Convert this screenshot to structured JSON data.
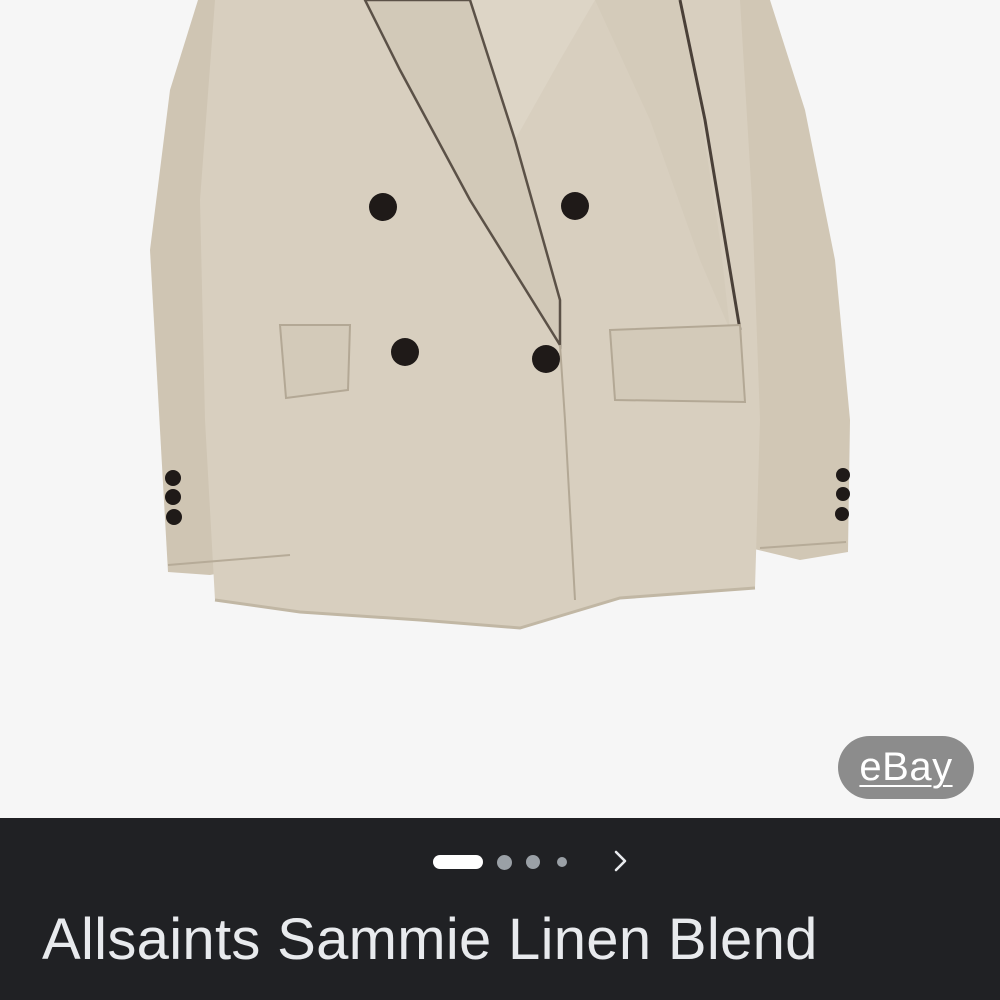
{
  "image_viewer": {
    "image_alt": "Allsaints Sammie Linen Blend blazer",
    "source_badge_label": "eBay"
  },
  "carousel": {
    "total_images": 4,
    "current_index": 0,
    "next_icon": "chevron-right-icon"
  },
  "result": {
    "title": "Allsaints Sammie Linen Blend"
  },
  "colors": {
    "panel_background": "#202124",
    "image_background": "#f6f6f6",
    "jacket_fabric": "#d6cdbd",
    "badge_background": "#8c8c8c"
  }
}
